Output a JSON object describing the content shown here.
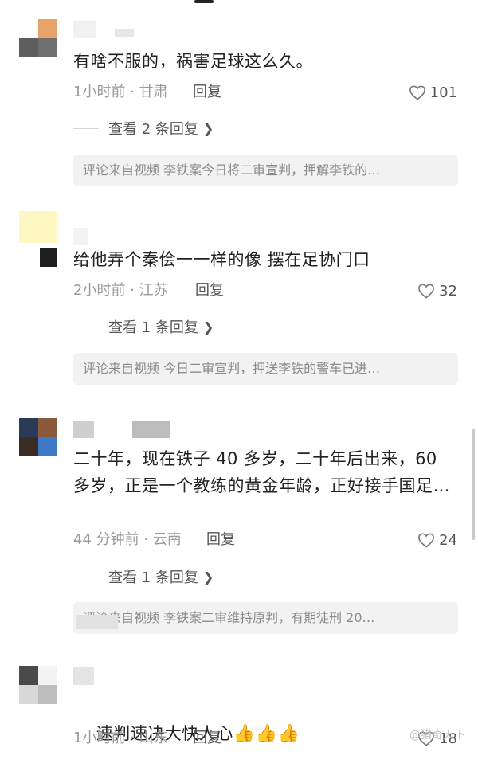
{
  "comments": [
    {
      "text": "有啥不服的，祸害足球这么久。",
      "time_location": "1小时前 · 甘肃",
      "reply_label": "回复",
      "likes": "101",
      "expand_label": "查看 2 条回复",
      "source": "评论来自视频 李铁案今日将二审宣判，押解李铁的…"
    },
    {
      "text": "给他弄个秦侩一一样的像 摆在足协门口",
      "time_location": "2小时前 · 江苏",
      "reply_label": "回复",
      "likes": "32",
      "expand_label": "查看 1 条回复",
      "source": "评论来自视频 今日二审宣判，押送李铁的警车已进…"
    },
    {
      "text": "二十年，现在铁子 40 多岁，二十年后出来，60 多岁，正是一个教练的黄金年龄，正好接手国足…",
      "time_location": "44 分钟前 · 云南",
      "reply_label": "回复",
      "likes": "24",
      "expand_label": "查看 1 条回复",
      "source": "评论来自视频 李铁案二审维持原判，有期徒刑 20…"
    },
    {
      "text": "速判速决大快人心",
      "emoji": "👍👍👍",
      "time_location": "1小时前 · 山东",
      "reply_label": "回复",
      "likes": "18"
    }
  ],
  "watermark": "@猎奇天下",
  "icons": {
    "like": "heart-outline-icon",
    "expand": "chevron-right-icon"
  }
}
